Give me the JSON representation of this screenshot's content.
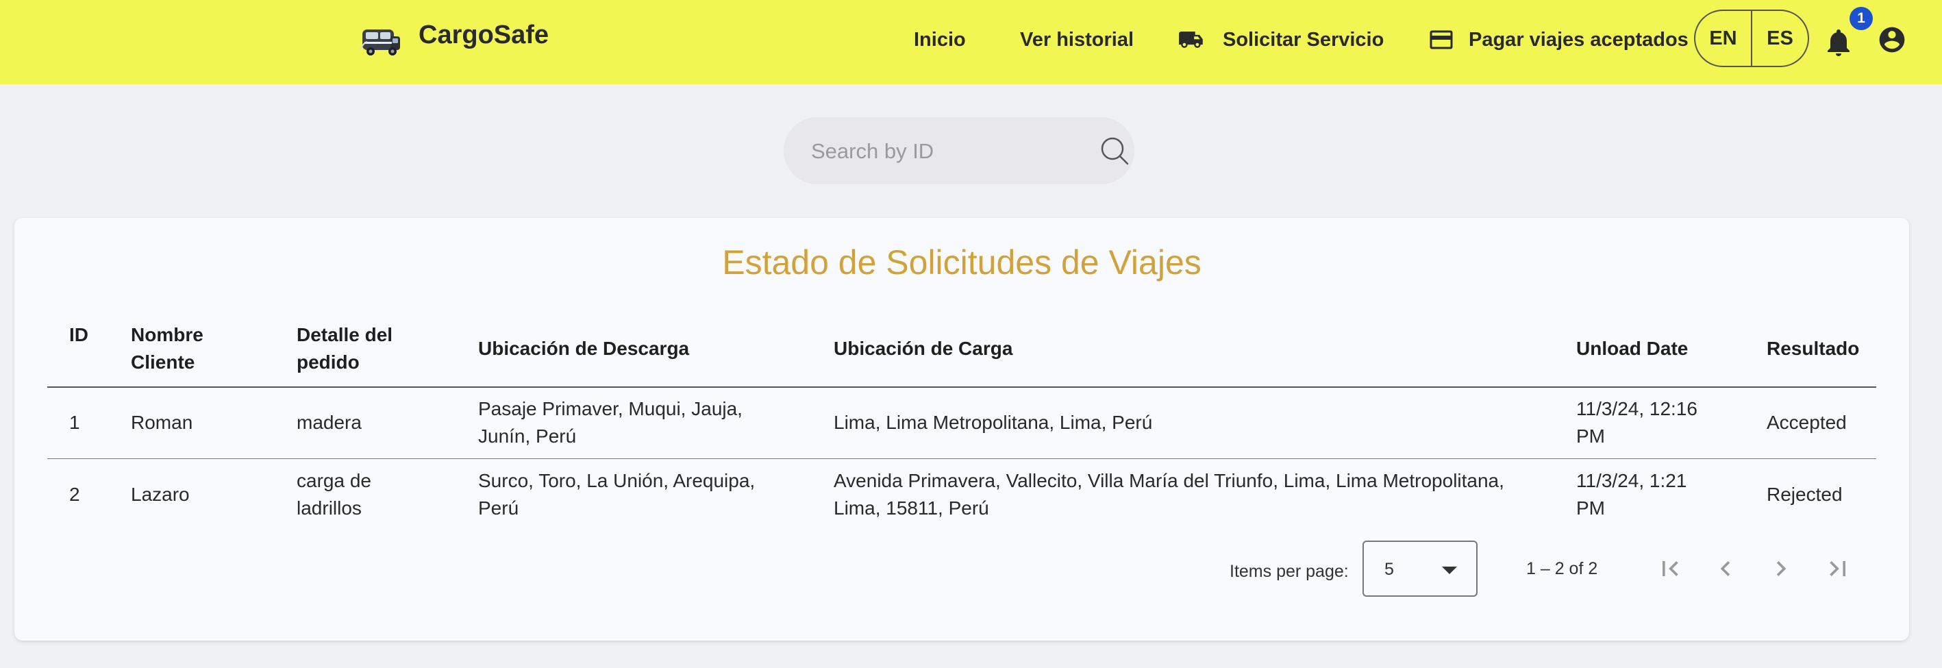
{
  "header": {
    "brand": "CargoSafe",
    "nav": {
      "home": "Inicio",
      "history": "Ver historial",
      "request": "Solicitar Servicio",
      "pay": "Pagar viajes aceptados"
    },
    "lang_en": "EN",
    "lang_es": "ES",
    "notifications_count": "1",
    "icons": {
      "logo": "truck-logo-icon",
      "request": "truck-icon",
      "pay": "credit-card-icon",
      "notifications": "bell-icon",
      "account": "account-circle-icon"
    },
    "bar_color": "#f2f652"
  },
  "search": {
    "placeholder": "Search by ID",
    "icon": "search-icon"
  },
  "table": {
    "title": "Estado de Solicitudes de Viajes",
    "title_color": "#d2a23a",
    "columns": {
      "id": "ID",
      "client_line1": "Nombre",
      "client_line2": "Cliente",
      "detail_line1": "Detalle del",
      "detail_line2": "pedido",
      "unload_location": "Ubicación de Descarga",
      "load_location": "Ubicación de Carga",
      "unload_date": "Unload Date",
      "result": "Resultado"
    },
    "rows": [
      {
        "id": "1",
        "client": "Roman",
        "detail": "madera",
        "unload_line1": "Pasaje Primaver, Muqui, Jauja,",
        "unload_line2": "Junín, Perú",
        "load_line1": "Lima, Lima Metropolitana, Lima, Perú",
        "date_line1": "11/3/24, 12:16",
        "date_line2": "PM",
        "result": "Accepted"
      },
      {
        "id": "2",
        "client": "Lazaro",
        "detail_line1": "carga de",
        "detail_line2": "ladrillos",
        "unload_line1": "Surco, Toro, La Unión, Arequipa,",
        "unload_line2": "Perú",
        "load_line1": "Avenida Primavera, Vallecito, Villa María del Triunfo, Lima, Lima Metropolitana,",
        "load_line2": "Lima, 15811, Perú",
        "date_line1": "11/3/24, 1:21",
        "date_line2": "PM",
        "result": "Rejected"
      }
    ]
  },
  "paginator": {
    "items_per_page_label": "Items per page:",
    "page_size": "5",
    "range": "1 – 2 of 2",
    "icons": [
      "first-page-icon",
      "previous-page-icon",
      "next-page-icon",
      "last-page-icon"
    ]
  }
}
